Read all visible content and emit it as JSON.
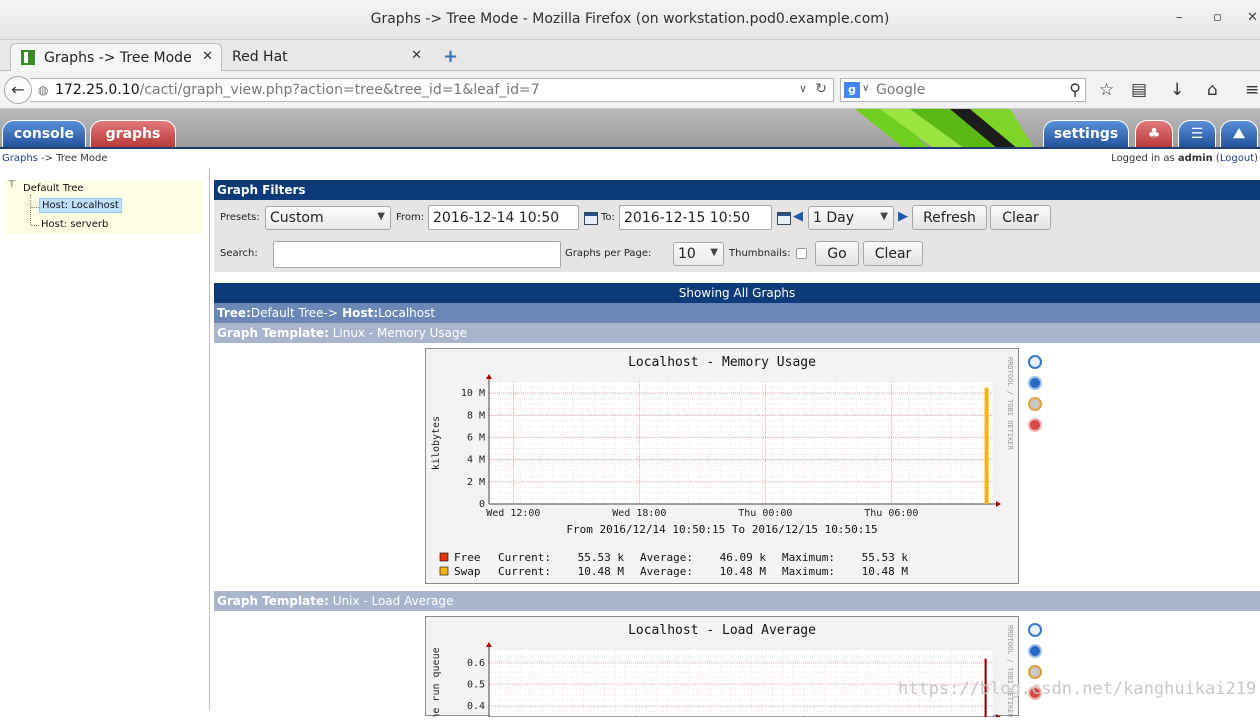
{
  "window": {
    "title": "Graphs -> Tree Mode - Mozilla Firefox (on workstation.pod0.example.com)",
    "minimize_glyph": "–",
    "maximize_glyph": "▫",
    "close_glyph": "✕"
  },
  "tabs": [
    {
      "label": "Graphs -> Tree Mode",
      "close": "✕",
      "active": true
    },
    {
      "label": "Red Hat",
      "close": "✕",
      "active": false
    }
  ],
  "new_tab_glyph": "+",
  "navbar": {
    "back_glyph": "←",
    "url_host": "172.25.0.10",
    "url_path": "/cacti/graph_view.php?action=tree&tree_id=1&leaf_id=7",
    "url_dropdown": "∨",
    "reload_glyph": "↻",
    "search_engine_letter": "g",
    "search_placeholder": "Google",
    "search_glyph": "🔍",
    "bookmark_glyph": "☆",
    "reader_glyph": "▤",
    "download_glyph": "↓",
    "home_glyph": "⌂",
    "menu_glyph": "≡"
  },
  "cacti_tabs": {
    "console": "console",
    "graphs": "graphs",
    "settings": "settings",
    "tree_glyph": "♣",
    "list_glyph": "☰",
    "preview_glyph": "⛰"
  },
  "breadcrumb": {
    "graphs_link": "Graphs",
    "separator": " -> ",
    "current": "Tree Mode"
  },
  "login": {
    "prefix": "Logged in as ",
    "user": "admin",
    "logout_open": " (",
    "logout": "Logout",
    "logout_close": ")"
  },
  "tree": {
    "root": "Default Tree",
    "hosts": [
      "Host: Localhost",
      "Host: serverb"
    ],
    "selected_index": 0
  },
  "filters": {
    "header": "Graph Filters",
    "presets_label": "Presets:",
    "presets_value": "Custom",
    "from_label": "From:",
    "from_value": "2016-12-14 10:50",
    "to_label": "To:",
    "to_value": "2016-12-15 10:50",
    "timespan_value": "1 Day",
    "refresh_label": "Refresh",
    "clear_label": "Clear",
    "search_label": "Search:",
    "search_value": "",
    "graphs_per_page_label": "Graphs per Page:",
    "graphs_per_page_value": "10",
    "thumbnails_label": "Thumbnails:",
    "thumbnails_checked": false,
    "go_label": "Go",
    "clear2_label": "Clear"
  },
  "showing_all": "Showing All Graphs",
  "tree_row": {
    "tree_label": "Tree:",
    "tree_value": "Default Tree->",
    "host_label": " Host:",
    "host_value": "Localhost"
  },
  "templates": [
    {
      "label": "Graph Template:",
      "value": " Linux - Memory Usage"
    },
    {
      "label": "Graph Template:",
      "value": " Unix - Load Average"
    }
  ],
  "chart_data": [
    {
      "type": "area",
      "title": "Localhost - Memory Usage",
      "ylabel": "kilobytes",
      "side_label": "RRDTOOL / TOBI OETIKER",
      "yticks": [
        "0",
        "2 M",
        "4 M",
        "6 M",
        "8 M",
        "10 M"
      ],
      "ytick_values": [
        0,
        2,
        4,
        6,
        8,
        10
      ],
      "ylim": [
        0,
        11
      ],
      "xticks": [
        "Wed 12:00",
        "Wed 18:00",
        "Thu 00:00",
        "Thu 06:00"
      ],
      "xtick_hours": [
        1.16,
        7.16,
        13.16,
        19.16
      ],
      "xlim_hours": [
        0,
        24
      ],
      "range_text": "From 2016/12/14 10:50:15 To 2016/12/15 10:50:15",
      "series": [
        {
          "name": "Free",
          "color": "#e8350f",
          "current": "55.53 k",
          "average": "46.09 k",
          "maximum": "55.53 k"
        },
        {
          "name": "Swap",
          "color": "#f8b30b",
          "current": "10.48 M",
          "average": "10.48 M",
          "maximum": "10.48 M",
          "spike_at_hours": 23.6,
          "spike_value": 10.48
        }
      ],
      "legend_labels": {
        "current": "Current:",
        "average": "Average:",
        "maximum": "Maximum:"
      }
    },
    {
      "type": "line",
      "title": "Localhost - Load Average",
      "ylabel": "he run queue",
      "side_label": "RRDTOOL / TOBI OETIKER",
      "yticks": [
        "0.4",
        "0.5",
        "0.6"
      ],
      "ytick_values": [
        0.4,
        0.5,
        0.6
      ],
      "ylim": [
        0.35,
        0.66
      ],
      "series": [
        {
          "spike_at_hours": 23.6,
          "spike_value": 0.62,
          "color": "#800000"
        }
      ]
    }
  ],
  "graph_action_icons": [
    "zoom-icon",
    "export-icon",
    "properties-icon",
    "anchor-icon"
  ],
  "watermark": "https://blog.csdn.net/kanghuikai219"
}
